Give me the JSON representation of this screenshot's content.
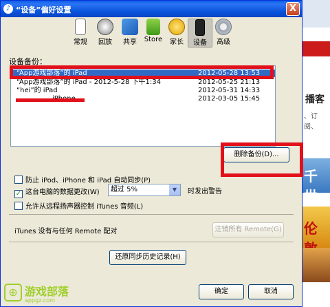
{
  "window": {
    "title": "“设备”偏好设置",
    "close_glyph": "X"
  },
  "toolbar": {
    "tabs": [
      {
        "label": "常规",
        "icon": "general-icon"
      },
      {
        "label": "回放",
        "icon": "playback-icon"
      },
      {
        "label": "共享",
        "icon": "sharing-icon"
      },
      {
        "label": "Store",
        "icon": "store-icon"
      },
      {
        "label": "家长",
        "icon": "parental-icon"
      },
      {
        "label": "设备",
        "icon": "devices-icon",
        "selected": true
      },
      {
        "label": "高级",
        "icon": "advanced-icon"
      }
    ]
  },
  "backups": {
    "label": "设备备份：",
    "rows": [
      {
        "name": "“App游戏部落”的 iPad",
        "date": "2012-05-28 13:53",
        "selected": true
      },
      {
        "name": "“App游戏部落”的 iPad - 2012-5-28 下午1:34",
        "date": "2012-05-25 21:13"
      },
      {
        "name": "“hei”的 iPad",
        "date": "2012-05-31 14:33"
      },
      {
        "name": "iPhone",
        "date": "2012-03-05 15:45"
      }
    ],
    "delete_button": "删除备份(D)..."
  },
  "options": {
    "prevent_sync_label": "防止 iPod、iPhone 和 iPad 自动同步(P)",
    "prevent_sync_checked": false,
    "warn_label": "这台电脑的数据更改(W)",
    "warn_checked": true,
    "warn_checkmark": "✓",
    "threshold_value": "超过 5%",
    "threshold_arrow": "▼",
    "warn_suffix": "时发出警告",
    "remote_speaker_label": "允许从远程扬声器控制 iTunes 音频(L)",
    "remote_speaker_checked": false
  },
  "remote": {
    "status": "iTunes 没有与任何 Remote 配对",
    "unpair_button": "注销所有 Remote(G)"
  },
  "reset_button": "还原同步历史记录(H)",
  "footer": {
    "ok": "确定",
    "cancel": "取消"
  },
  "background": {
    "heading": "播客",
    "subtext": "、订阅、",
    "ad_text_1": "千世",
    "ad_text_2": "伦敦"
  },
  "watermark": {
    "logo_glyph": "⊕",
    "name": "游戏部落",
    "url": "appgz.com"
  },
  "colors": {
    "accent_selection": "#316ac5",
    "annotation_red": "#e2101a",
    "titlebar_blue": "#0a5fe6"
  }
}
